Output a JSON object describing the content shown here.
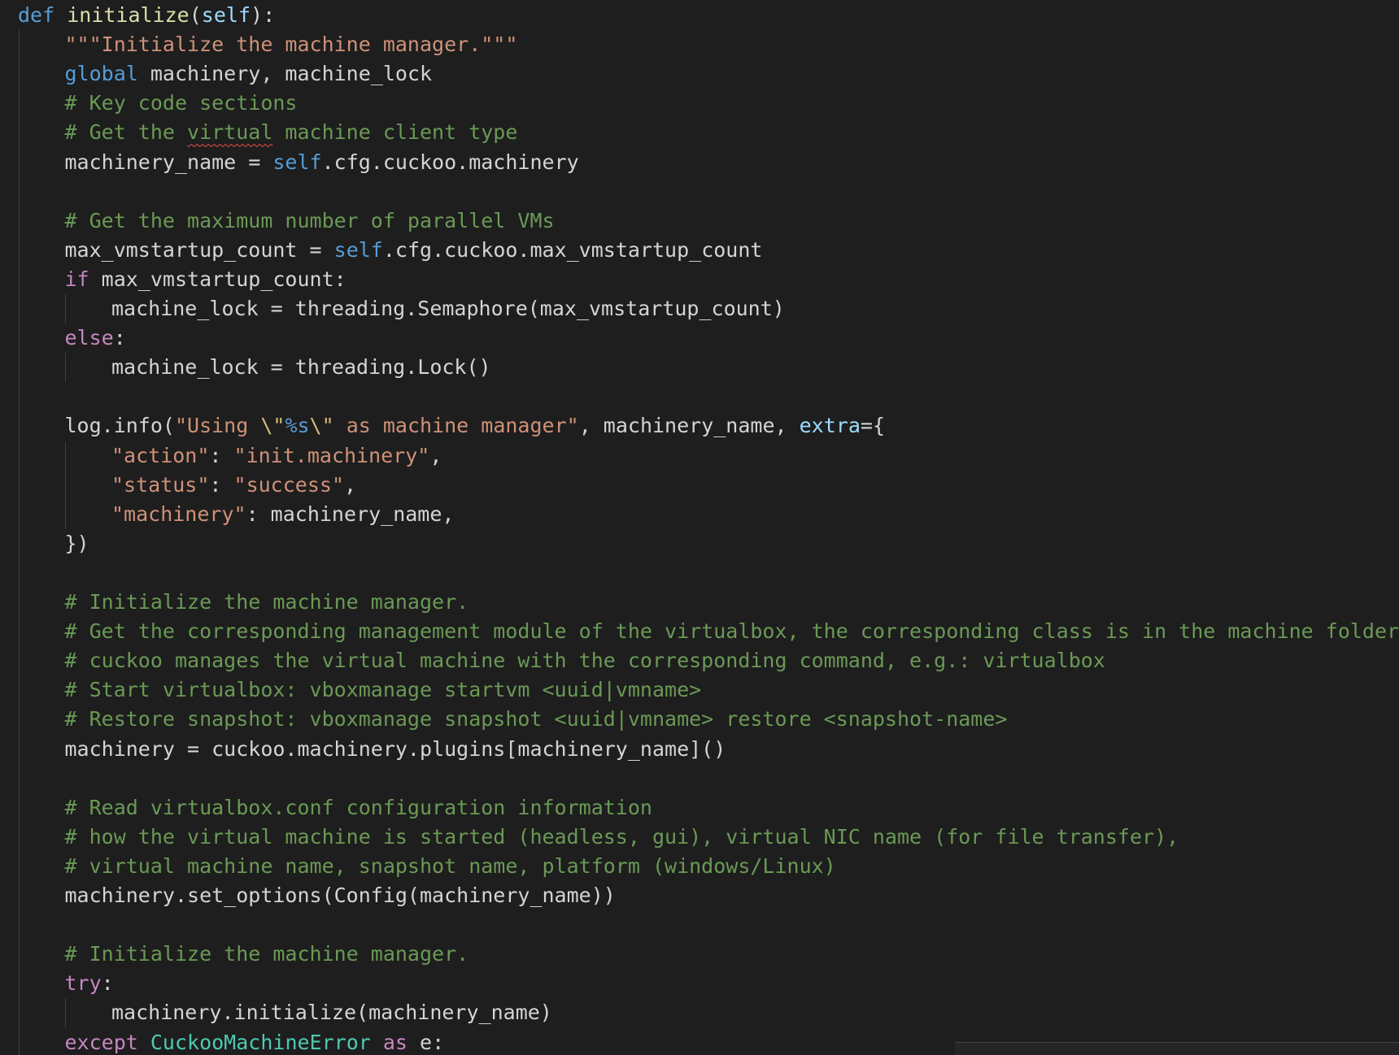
{
  "editor": {
    "language": "python",
    "colors": {
      "background": "#1e1e1e",
      "keyword": "#569cd6",
      "control": "#c586c0",
      "function": "#dcdcaa",
      "string": "#ce9178",
      "comment": "#6a9955",
      "class": "#4ec9b0",
      "parameter": "#9cdcfe",
      "error_squiggle": "#f14c4c"
    },
    "lines": [
      {
        "indent": 0,
        "tokens": [
          [
            "kw-blue",
            "def"
          ],
          [
            "",
            " "
          ],
          [
            "fn",
            "initialize"
          ],
          [
            "",
            "("
          ],
          [
            "param",
            "self"
          ],
          [
            "",
            "):"
          ]
        ]
      },
      {
        "indent": 1,
        "tokens": [
          [
            "str",
            "\"\"\"Initialize the machine manager.\"\"\""
          ]
        ]
      },
      {
        "indent": 1,
        "tokens": [
          [
            "kw-blue",
            "global"
          ],
          [
            "",
            " machinery, machine_lock"
          ]
        ]
      },
      {
        "indent": 1,
        "tokens": [
          [
            "cmt",
            "# Key code sections"
          ]
        ]
      },
      {
        "indent": 1,
        "tokens": [
          [
            "cmt",
            "# Get the "
          ],
          [
            "cmt squiggle",
            "virtual"
          ],
          [
            "cmt",
            " machine client type"
          ]
        ]
      },
      {
        "indent": 1,
        "tokens": [
          [
            "",
            "machinery_name = "
          ],
          [
            "kw-blue",
            "self"
          ],
          [
            "",
            ".cfg.cuckoo.machinery"
          ]
        ]
      },
      {
        "indent": 0,
        "tokens": []
      },
      {
        "indent": 1,
        "tokens": [
          [
            "cmt",
            "# Get the maximum number of parallel VMs"
          ]
        ]
      },
      {
        "indent": 1,
        "tokens": [
          [
            "",
            "max_vmstartup_count = "
          ],
          [
            "kw-blue",
            "self"
          ],
          [
            "",
            ".cfg.cuckoo.max_vmstartup_count"
          ]
        ]
      },
      {
        "indent": 1,
        "tokens": [
          [
            "kw-purple",
            "if"
          ],
          [
            "",
            " max_vmstartup_count:"
          ]
        ]
      },
      {
        "indent": 2,
        "tokens": [
          [
            "",
            "machine_lock = threading.Semaphore(max_vmstartup_count)"
          ]
        ]
      },
      {
        "indent": 1,
        "tokens": [
          [
            "kw-purple",
            "else"
          ],
          [
            "",
            ":"
          ]
        ]
      },
      {
        "indent": 2,
        "tokens": [
          [
            "",
            "machine_lock = threading.Lock()"
          ]
        ]
      },
      {
        "indent": 0,
        "tokens": []
      },
      {
        "indent": 1,
        "tokens": [
          [
            "",
            "log.info("
          ],
          [
            "str",
            "\"Using "
          ],
          [
            "esc",
            "\\\""
          ],
          [
            "fmt",
            "%s"
          ],
          [
            "esc",
            "\\\""
          ],
          [
            "str",
            " as machine manager\""
          ],
          [
            "",
            ", machinery_name, "
          ],
          [
            "param",
            "extra"
          ],
          [
            "",
            "={"
          ]
        ]
      },
      {
        "indent": 2,
        "tokens": [
          [
            "str",
            "\"action\""
          ],
          [
            "",
            ": "
          ],
          [
            "str",
            "\"init.machinery\""
          ],
          [
            "",
            ","
          ]
        ]
      },
      {
        "indent": 2,
        "tokens": [
          [
            "str",
            "\"status\""
          ],
          [
            "",
            ": "
          ],
          [
            "str",
            "\"success\""
          ],
          [
            "",
            ","
          ]
        ]
      },
      {
        "indent": 2,
        "tokens": [
          [
            "str",
            "\"machinery\""
          ],
          [
            "",
            ": machinery_name,"
          ]
        ]
      },
      {
        "indent": 1,
        "tokens": [
          [
            "",
            "})"
          ]
        ]
      },
      {
        "indent": 0,
        "tokens": []
      },
      {
        "indent": 1,
        "tokens": [
          [
            "cmt",
            "# Initialize the machine manager."
          ]
        ]
      },
      {
        "indent": 1,
        "tokens": [
          [
            "cmt",
            "# Get the corresponding management module of the virtualbox, the corresponding class is in the machine folder"
          ]
        ]
      },
      {
        "indent": 1,
        "tokens": [
          [
            "cmt",
            "# cuckoo manages the virtual machine with the corresponding command, e.g.: virtualbox"
          ]
        ]
      },
      {
        "indent": 1,
        "tokens": [
          [
            "cmt",
            "# Start virtualbox: vboxmanage startvm <uuid|vmname>"
          ]
        ]
      },
      {
        "indent": 1,
        "tokens": [
          [
            "cmt",
            "# Restore snapshot: vboxmanage snapshot <uuid|vmname> restore <snapshot-name>"
          ]
        ]
      },
      {
        "indent": 1,
        "tokens": [
          [
            "",
            "machinery = cuckoo.machinery.plugins[machinery_name]()"
          ]
        ]
      },
      {
        "indent": 0,
        "tokens": []
      },
      {
        "indent": 1,
        "tokens": [
          [
            "cmt",
            "# Read virtualbox.conf configuration information"
          ]
        ]
      },
      {
        "indent": 1,
        "tokens": [
          [
            "cmt",
            "# how the virtual machine is started (headless, gui), virtual NIC name (for file transfer),"
          ]
        ]
      },
      {
        "indent": 1,
        "tokens": [
          [
            "cmt",
            "# virtual machine name, snapshot name, platform (windows/Linux)"
          ]
        ]
      },
      {
        "indent": 1,
        "tokens": [
          [
            "",
            "machinery.set_options(Config(machinery_name))"
          ]
        ]
      },
      {
        "indent": 0,
        "tokens": []
      },
      {
        "indent": 1,
        "tokens": [
          [
            "cmt",
            "# Initialize the machine manager."
          ]
        ]
      },
      {
        "indent": 1,
        "tokens": [
          [
            "kw-purple",
            "try"
          ],
          [
            "",
            ":"
          ]
        ]
      },
      {
        "indent": 2,
        "tokens": [
          [
            "",
            "machinery.initialize(machinery_name)"
          ]
        ]
      },
      {
        "indent": 1,
        "tokens": [
          [
            "kw-purple",
            "except"
          ],
          [
            "",
            " "
          ],
          [
            "cls",
            "CuckooMachineError"
          ],
          [
            "",
            " "
          ],
          [
            "kw-purple",
            "as"
          ],
          [
            "",
            " e:"
          ]
        ]
      }
    ]
  }
}
